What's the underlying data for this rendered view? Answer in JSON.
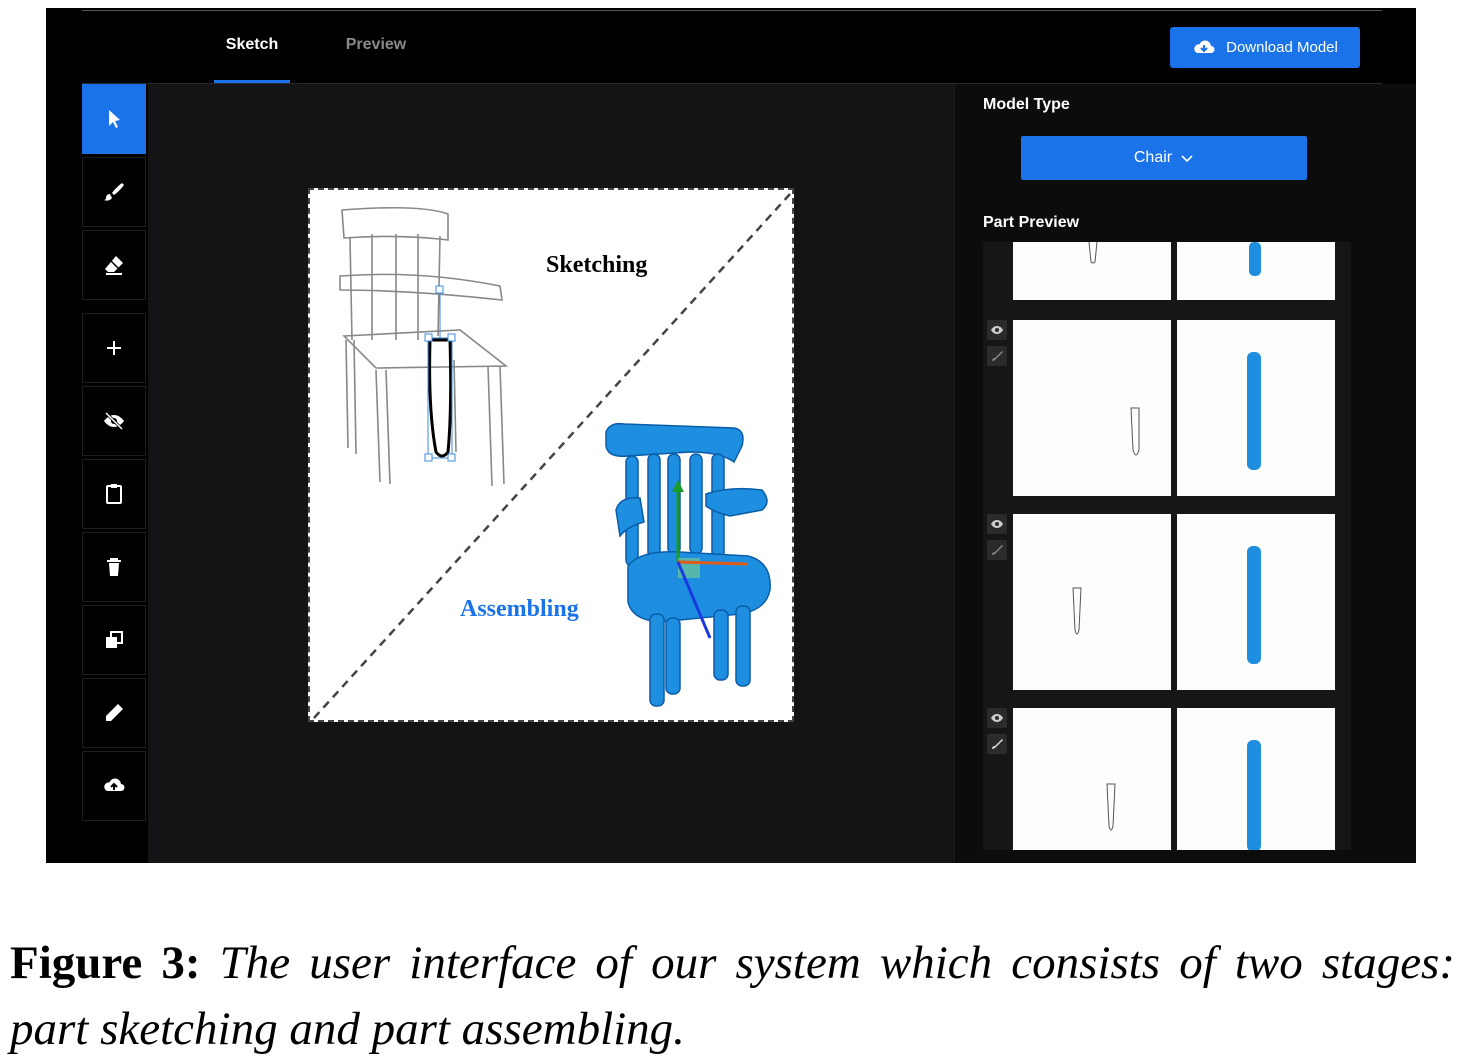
{
  "tabs": [
    {
      "label": "Sketch",
      "active": true
    },
    {
      "label": "Preview",
      "active": false
    }
  ],
  "download_button": {
    "label": "Download Model",
    "icon": "cloud-download-icon"
  },
  "toolbar": {
    "tools": [
      {
        "name": "select-tool",
        "icon": "cursor-icon",
        "active": true
      },
      {
        "name": "brush-tool",
        "icon": "brush-icon"
      },
      {
        "name": "eraser-tool",
        "icon": "eraser-icon"
      },
      {
        "name": "add-part-tool",
        "icon": "plus-icon"
      },
      {
        "name": "hide-part-tool",
        "icon": "eye-off-icon"
      },
      {
        "name": "clipboard-tool",
        "icon": "clipboard-icon"
      },
      {
        "name": "delete-tool",
        "icon": "trash-icon"
      },
      {
        "name": "duplicate-tool",
        "icon": "copy-icon"
      },
      {
        "name": "pencil-tool",
        "icon": "pencil-icon"
      },
      {
        "name": "upload-tool",
        "icon": "cloud-upload-icon"
      }
    ]
  },
  "canvas": {
    "sketching_label": "Sketching",
    "assembling_label": "Assembling"
  },
  "panel": {
    "model_type_label": "Model Type",
    "model_type_value": "Chair",
    "part_preview_label": "Part Preview",
    "parts_count_visible": 4
  },
  "caption": {
    "prefix": "Figure 3:",
    "text": "The user interface of our system which consists of two stages: part sketching and part assembling."
  },
  "colors": {
    "accent": "#1a73e8",
    "model_blue": "#1e8fe0",
    "background": "#000000"
  }
}
